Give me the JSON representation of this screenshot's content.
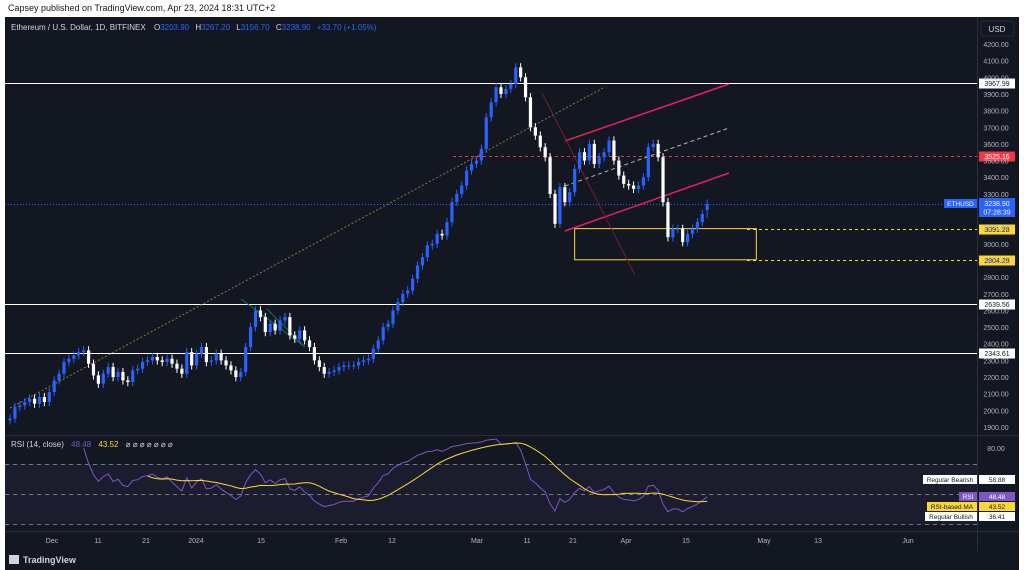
{
  "header": {
    "text": "Capsey published on TradingView.com, Apr 23, 2024 18:31 UTC+2"
  },
  "legend": {
    "symbol": "Ethereum / U.S. Dollar, 1D, BITFINEX",
    "o_label": "O",
    "o": "3203.90",
    "h_label": "H",
    "h": "3267.20",
    "l_label": "L",
    "l": "3156.70",
    "c_label": "C",
    "c": "3238.90",
    "change": "+33.70 (+1.05%)"
  },
  "currency": "USD",
  "price_axis": [
    "4200.00",
    "4100.00",
    "4000.00",
    "3900.00",
    "3800.00",
    "3700.00",
    "3600.00",
    "3500.00",
    "3400.00",
    "3300.00",
    "3200.00",
    "3100.00",
    "3000.00",
    "2900.00",
    "2800.00",
    "2700.00",
    "2600.00",
    "2500.00",
    "2400.00",
    "2300.00",
    "2200.00",
    "2100.00",
    "2000.00",
    "1900.00"
  ],
  "levels": [
    {
      "value": "3967.99",
      "style": "white"
    },
    {
      "value": "3525.16",
      "style": "red"
    },
    {
      "value": "3091.28",
      "style": "yellow"
    },
    {
      "value": "2904.29",
      "style": "yellow"
    },
    {
      "value": "2639.56",
      "style": "white"
    },
    {
      "value": "2343.61",
      "style": "white"
    }
  ],
  "last_price": {
    "ticker": "ETHUSD",
    "price": "3238.90",
    "countdown": "07:28:39"
  },
  "rsi": {
    "title": "RSI (14, close)",
    "value": "48.48",
    "ma": "43.52",
    "placeholders": "⌀ ⌀ ⌀ ⌀ ⌀ ⌀ ⌀",
    "axis_top": "80.00",
    "tags": {
      "regular_bearish": "Regular Bearish",
      "bearish_value": "58.88",
      "rsi_label": "RSI",
      "rsi_value": "48.48",
      "ma_label": "RSI-based MA",
      "ma_value": "43.52",
      "regular_bullish": "Regular Bullish",
      "bullish_value": "36.41"
    }
  },
  "time_axis": [
    "Dec",
    "11",
    "21",
    "2024",
    "15",
    "Feb",
    "12",
    "Mar",
    "11",
    "21",
    "Apr",
    "15",
    "May",
    "13",
    "Jun"
  ],
  "branding": "TradingView",
  "colors": {
    "background": "#131722",
    "up": "#2962ff",
    "down": "#ffffff",
    "channel": "#e91e63",
    "rsi_line": "#7e57c2",
    "rsi_ma": "#fdd835",
    "box": "#fdd835",
    "red_level": "#f23645"
  },
  "chart_data": {
    "type": "candlestick",
    "symbol": "ETHUSD",
    "timeframe": "1D",
    "y_range": [
      1900,
      4200
    ],
    "x_ticks": [
      "Dec",
      "11",
      "21",
      "2024",
      "15",
      "Feb",
      "12",
      "Mar",
      "11",
      "21",
      "Apr",
      "15",
      "May",
      "13",
      "Jun"
    ],
    "horizontal_levels": [
      3967.99,
      3525.16,
      3091.28,
      2904.29,
      2639.56,
      2343.61
    ],
    "demand_box": {
      "from": "2024-03-19",
      "to": "2024-04-25",
      "low": 2904.29,
      "high": 3091.28
    },
    "close_series": {
      "start_date": "2023-11-25",
      "closes": [
        1950,
        2020,
        2030,
        2050,
        2070,
        2040,
        2080,
        2050,
        2110,
        2180,
        2220,
        2290,
        2310,
        2330,
        2350,
        2360,
        2280,
        2210,
        2160,
        2220,
        2260,
        2200,
        2230,
        2180,
        2170,
        2240,
        2250,
        2290,
        2300,
        2320,
        2300,
        2290,
        2310,
        2280,
        2250,
        2220,
        2350,
        2270,
        2340,
        2380,
        2290,
        2300,
        2340,
        2300,
        2270,
        2240,
        2200,
        2230,
        2380,
        2500,
        2600,
        2560,
        2470,
        2520,
        2480,
        2540,
        2560,
        2450,
        2430,
        2480,
        2420,
        2380,
        2300,
        2260,
        2220,
        2230,
        2240,
        2260,
        2270,
        2270,
        2270,
        2290,
        2300,
        2310,
        2370,
        2420,
        2500,
        2520,
        2600,
        2650,
        2700,
        2720,
        2790,
        2870,
        2920,
        2990,
        3000,
        3060,
        3050,
        3130,
        3250,
        3300,
        3350,
        3440,
        3480,
        3500,
        3570,
        3760,
        3850,
        3940,
        3900,
        3930,
        3960,
        4060,
        4000,
        3880,
        3700,
        3650,
        3580,
        3520,
        3300,
        3120,
        3340,
        3250,
        3310,
        3450,
        3550,
        3500,
        3600,
        3480,
        3520,
        3550,
        3620,
        3500,
        3410,
        3360,
        3350,
        3330,
        3350,
        3400,
        3580,
        3600,
        3520,
        3250,
        3040,
        3090,
        3090,
        3010,
        3060,
        3090,
        3130,
        3180,
        3240
      ],
      "opens": [
        1940,
        1950,
        2020,
        2030,
        2050,
        2070,
        2040,
        2080,
        2050,
        2110,
        2180,
        2220,
        2290,
        2310,
        2330,
        2350,
        2360,
        2280,
        2210,
        2160,
        2220,
        2260,
        2200,
        2230,
        2180,
        2170,
        2240,
        2250,
        2290,
        2300,
        2320,
        2300,
        2290,
        2310,
        2280,
        2250,
        2220,
        2350,
        2270,
        2340,
        2380,
        2290,
        2300,
        2340,
        2300,
        2270,
        2240,
        2200,
        2230,
        2380,
        2500,
        2600,
        2560,
        2470,
        2520,
        2480,
        2540,
        2560,
        2450,
        2430,
        2480,
        2420,
        2380,
        2300,
        2260,
        2220,
        2230,
        2240,
        2260,
        2270,
        2270,
        2270,
        2290,
        2300,
        2310,
        2370,
        2420,
        2500,
        2520,
        2600,
        2650,
        2700,
        2720,
        2790,
        2870,
        2920,
        2990,
        3000,
        3060,
        3050,
        3130,
        3250,
        3300,
        3350,
        3440,
        3480,
        3500,
        3570,
        3760,
        3850,
        3940,
        3900,
        3930,
        3960,
        4060,
        4000,
        3880,
        3700,
        3650,
        3580,
        3520,
        3300,
        3120,
        3340,
        3250,
        3310,
        3450,
        3550,
        3500,
        3600,
        3480,
        3520,
        3550,
        3620,
        3500,
        3410,
        3360,
        3350,
        3330,
        3350,
        3400,
        3580,
        3600,
        3520,
        3250,
        3040,
        3090,
        3090,
        3010,
        3060,
        3090,
        3130,
        3203.9
      ],
      "last": {
        "open": 3203.9,
        "high": 3267.2,
        "low": 3156.7,
        "close": 3238.9
      }
    },
    "rsi": {
      "length": 14,
      "last": 48.48,
      "ma_last": 43.52,
      "bearish_level": 58.88,
      "bullish_level": 36.41
    }
  }
}
